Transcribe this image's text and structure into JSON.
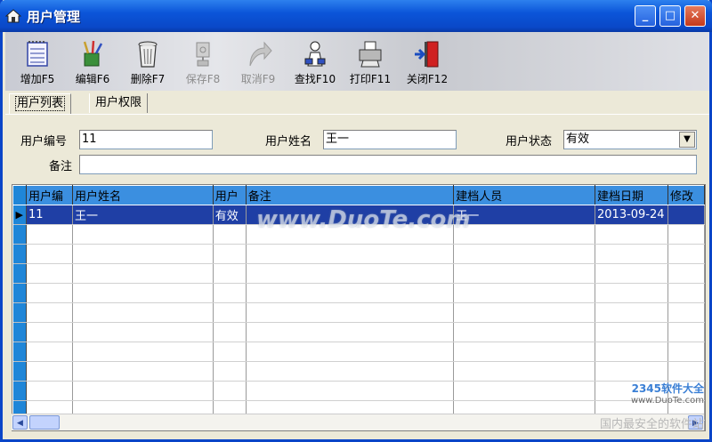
{
  "window": {
    "title": "用户管理"
  },
  "toolbar": [
    {
      "label": "增加F5",
      "icon": "notebook-add-icon",
      "enabled": true
    },
    {
      "label": "编辑F6",
      "icon": "brush-edit-icon",
      "enabled": true
    },
    {
      "label": "删除F7",
      "icon": "trash-can-icon",
      "enabled": true
    },
    {
      "label": "保存F8",
      "icon": "save-disk-icon",
      "enabled": false
    },
    {
      "label": "取消F9",
      "icon": "undo-arrow-icon",
      "enabled": false
    },
    {
      "label": "查找F10",
      "icon": "search-person-icon",
      "enabled": true
    },
    {
      "label": "打印F11",
      "icon": "printer-icon",
      "enabled": true
    },
    {
      "label": "关闭F12",
      "icon": "exit-door-icon",
      "enabled": true
    }
  ],
  "tabs": [
    {
      "label": "用户列表",
      "active": true
    },
    {
      "label": "用户权限",
      "active": false
    }
  ],
  "form": {
    "user_id_label": "用户编号",
    "user_id_value": "11",
    "user_name_label": "用户姓名",
    "user_name_value": "王一",
    "status_label": "用户状态",
    "status_value": "有效",
    "note_label": "备注",
    "note_value": ""
  },
  "grid": {
    "columns": [
      "用户编",
      "用户姓名",
      "用户",
      "备注",
      "建档人员",
      "建档日期",
      "修改"
    ],
    "rows": [
      [
        "11",
        "王一",
        "有效",
        "",
        "王一",
        "2013-09-24",
        ""
      ]
    ],
    "empty_rows": 11
  },
  "watermark": {
    "center": "www.DuoTe.com",
    "corner_brand": "2345软件大全",
    "corner_url": "www.DuoTe.com",
    "corner_slogan": "国内最安全的软件站"
  },
  "colors": {
    "title_bar": "#0a48c8",
    "grid_header": "#3b8fe0",
    "selected_row": "#1f3fa5"
  }
}
